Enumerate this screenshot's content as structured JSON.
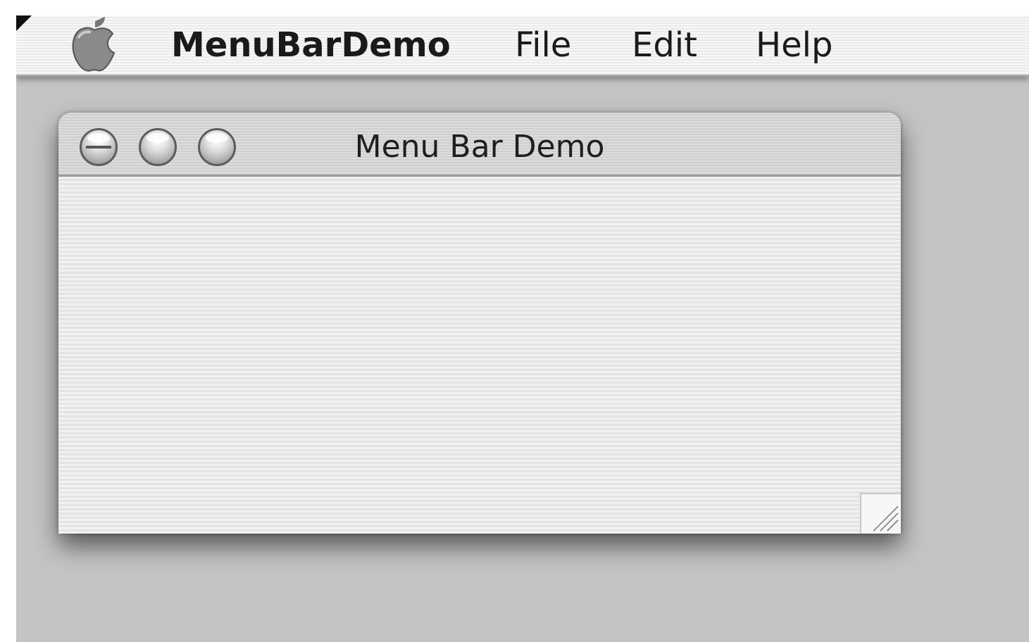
{
  "menubar": {
    "apple_icon": "apple-icon",
    "app_name": "MenuBarDemo",
    "items": [
      {
        "label": "File"
      },
      {
        "label": "Edit"
      },
      {
        "label": "Help"
      }
    ]
  },
  "window": {
    "title": "Menu Bar Demo",
    "buttons": {
      "close_icon": "close-icon",
      "minimize_icon": "minimize-icon",
      "zoom_icon": "zoom-icon"
    },
    "resize_icon": "resize-grip-icon"
  }
}
